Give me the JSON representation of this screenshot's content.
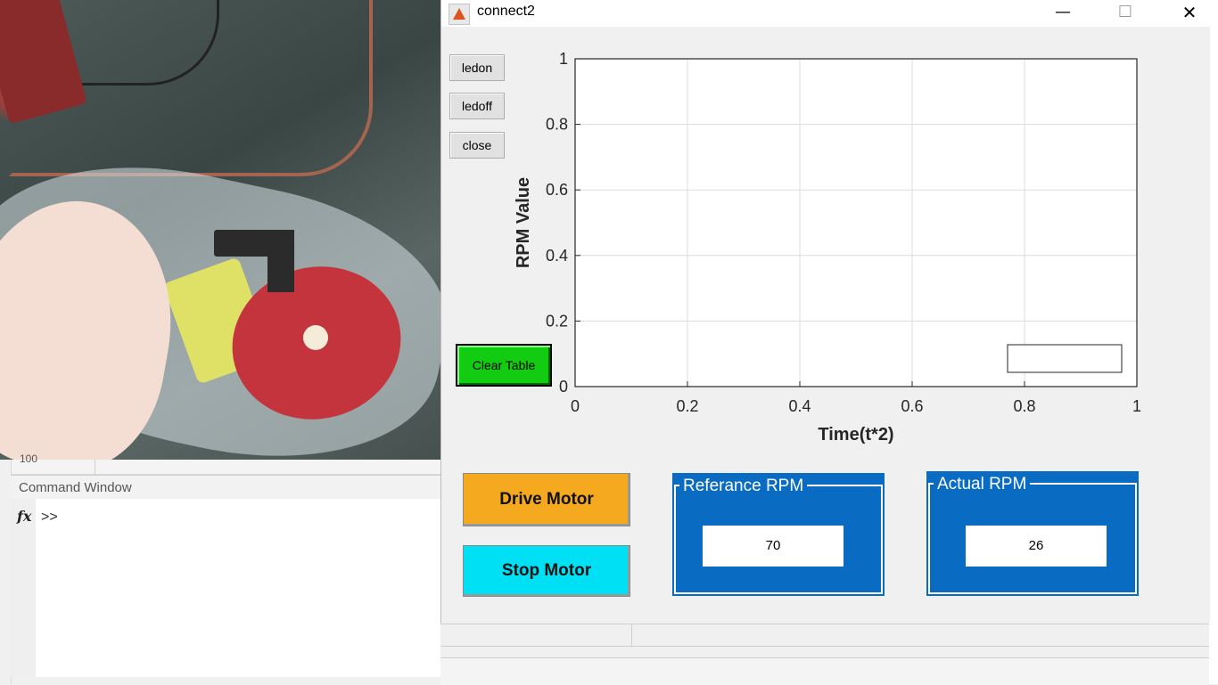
{
  "window": {
    "title": "connect2",
    "minimize_glyph": "—",
    "maximize_glyph": "☐",
    "close_glyph": "✕"
  },
  "figure_buttons": {
    "ledon": "ledon",
    "ledoff": "ledoff",
    "close": "close",
    "clear_table": "Clear Table",
    "drive_motor": "Drive Motor",
    "stop_motor": "Stop Motor"
  },
  "panels": {
    "reference": {
      "title": "Referance RPM",
      "value": "70"
    },
    "actual": {
      "title": "Actual RPM",
      "value": "26"
    }
  },
  "command_window": {
    "title": "Command Window",
    "fx_label": "fx",
    "prompt": ">>",
    "zoom_value": "100"
  },
  "colors": {
    "clear_button": "#11cc11",
    "drive_button": "#f5a91f",
    "stop_button": "#00e0f4",
    "panel_blue": "#0a6bc3"
  },
  "chart_data": {
    "type": "line",
    "xlabel": "Time(t*2)",
    "ylabel": "RPM Value",
    "xlim": [
      0,
      1
    ],
    "ylim": [
      0,
      1
    ],
    "xticks": [
      "0",
      "0.2",
      "0.4",
      "0.6",
      "0.8",
      "1"
    ],
    "yticks": [
      "0",
      "0.2",
      "0.4",
      "0.6",
      "0.8",
      "1"
    ],
    "grid": true,
    "legend": "bottom-right",
    "series": []
  }
}
